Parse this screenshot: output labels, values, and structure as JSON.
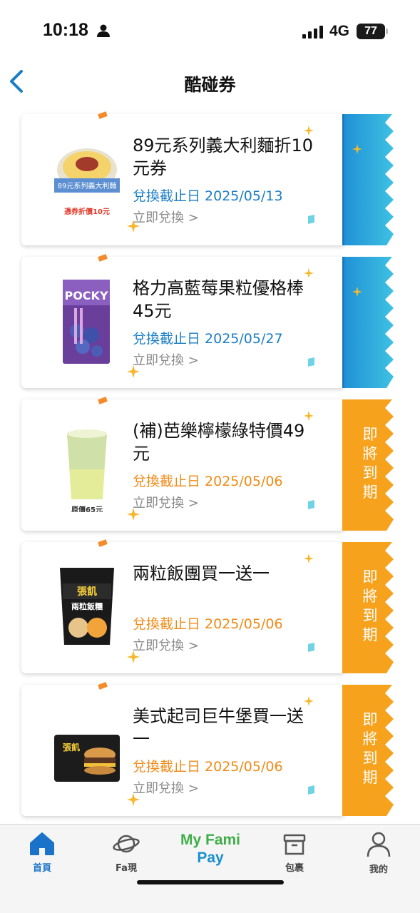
{
  "status_bar": {
    "time": "10:18",
    "network": "4G",
    "battery": "77"
  },
  "header": {
    "title": "酷碰券"
  },
  "colors": {
    "blue_tab": "#2ea3dc",
    "orange_tab": "#f7a21c",
    "blue_text": "#1a7dc4",
    "orange_text": "#f08a16"
  },
  "coupons": [
    {
      "title": "89元系列義大利麵折10元券",
      "deadline": "兌換截止日 2025/05/13",
      "redeem": "立即兌換 >",
      "tab_color": "blue",
      "tab_label": "",
      "image_banner": "89元系列義大利麵",
      "image_note": "憑券折價10元"
    },
    {
      "title": "格力高藍莓果粒優格棒45元",
      "deadline": "兌換截止日 2025/05/27",
      "redeem": "立即兌換 >",
      "tab_color": "blue",
      "tab_label": "",
      "image_banner": "POCKY"
    },
    {
      "title": "(補)芭樂檸檬綠特價49元",
      "deadline": "兌換截止日 2025/05/06",
      "redeem": "立即兌換 >",
      "tab_color": "orange",
      "tab_label": "即將到期",
      "image_note": "原價65元"
    },
    {
      "title": "兩粒飯團買一送一",
      "deadline": "兌換截止日 2025/05/06",
      "redeem": "立即兌換 >",
      "tab_color": "orange",
      "tab_label": "即將到期",
      "image_banner": "兩粒飯糰"
    },
    {
      "title": "美式起司巨牛堡買一送一",
      "deadline": "兌換截止日 2025/05/06",
      "redeem": "立即兌換 >",
      "tab_color": "orange",
      "tab_label": "即將到期"
    }
  ],
  "bottom_nav": {
    "home": "首頁",
    "fa": "Fa現",
    "pay_line1": "My Fami",
    "pay_line2": "Pay",
    "parcel": "包裹",
    "mine": "我的"
  }
}
